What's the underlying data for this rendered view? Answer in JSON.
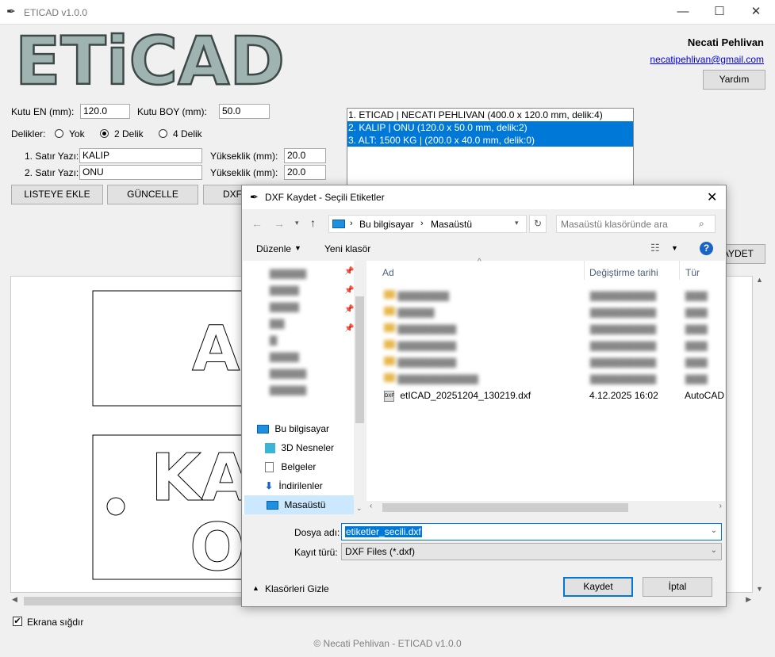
{
  "window": {
    "title": "ETICAD v1.0.0",
    "minimize": "—",
    "maximize": "☐",
    "close": "✕"
  },
  "logo": {
    "text": "ETiCAD"
  },
  "author": {
    "name": "Necati Pehlivan",
    "email": "necatipehlivan@gmail.com",
    "help_button": "Yardım"
  },
  "form": {
    "kutu_en_label": "Kutu EN (mm):",
    "kutu_en_value": "120.0",
    "kutu_boy_label": "Kutu BOY (mm):",
    "kutu_boy_value": "50.0",
    "delikler_label": "Delikler:",
    "radio_options": [
      "Yok",
      "2 Delik",
      "4 Delik"
    ],
    "selected_radio": "2 Delik",
    "satir1_label": "1. Satır Yazı:",
    "satir1_value": "KALIP",
    "satir2_label": "2. Satır Yazı:",
    "satir2_value": "ONU",
    "yukseklik_label": "Yükseklik (mm):",
    "yukseklik1_value": "20.0",
    "yukseklik2_value": "20.0",
    "btn_add": "LISTEYE EKLE",
    "btn_update": "GÜNCELLE",
    "btn_dxf": "DXF",
    "btn_save_partial": "AYDET"
  },
  "list": {
    "items": [
      {
        "text": "1. ETICAD | NECATI PEHLIVAN  (400.0 x 120.0 mm, delik:4)",
        "selected": false
      },
      {
        "text": "2. KALIP | ONU  (120.0 x 50.0 mm, delik:2)",
        "selected": true
      },
      {
        "text": "3. ALT: 1500 KG |   (200.0 x 40.0 mm, delik:0)",
        "selected": true
      }
    ]
  },
  "canvas": {
    "label_text_1": "AL",
    "label_text_2a": "KA",
    "label_text_2b": "O"
  },
  "fit_checkbox": {
    "label": "Ekrana sığdır",
    "checked": true
  },
  "footer": {
    "text": "© Necati Pehlivan - ETICAD v1.0.0"
  },
  "dialog": {
    "title": "DXF Kaydet - Seçili Etiketler",
    "breadcrumb": [
      "Bu bilgisayar",
      "Masaüstü"
    ],
    "search_placeholder": "Masaüstü klasöründe ara",
    "organize": "Düzenle",
    "new_folder": "Yeni klasör",
    "columns": {
      "name": "Ad",
      "date": "Değiştirme tarihi",
      "type": "Tür"
    },
    "nav_items": [
      {
        "label": "Bu bilgisayar",
        "icon": "computer-icon"
      },
      {
        "label": "3D Nesneler",
        "icon": "cube-icon"
      },
      {
        "label": "Belgeler",
        "icon": "document-icon"
      },
      {
        "label": "İndirilenler",
        "icon": "download-icon"
      },
      {
        "label": "Masaüstü",
        "icon": "desktop-icon",
        "selected": true
      }
    ],
    "files": [
      {
        "name": "etICAD_20251204_130219.dxf",
        "date": "4.12.2025 16:02",
        "type": "AutoCAD"
      }
    ],
    "filename_label": "Dosya adı:",
    "filename_value": "etiketler_secili.dxf",
    "filetype_label": "Kayıt türü:",
    "filetype_value": "DXF Files (*.dxf)",
    "hide_folders": "Klasörleri Gizle",
    "save_button": "Kaydet",
    "cancel_button": "İptal"
  },
  "colors": {
    "selection": "#0078d7",
    "logo_fill": "#9fb3b1",
    "accent_link": "#0000ee"
  }
}
